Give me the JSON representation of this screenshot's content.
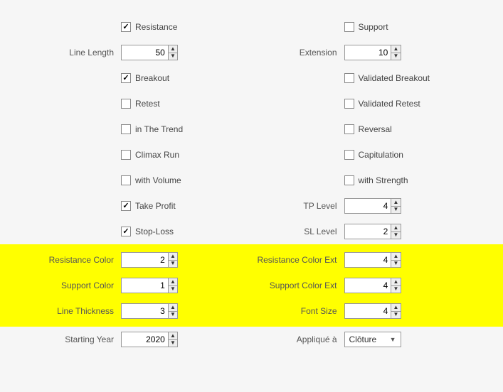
{
  "checkboxes": {
    "resistance": "Resistance",
    "support": "Support",
    "breakout": "Breakout",
    "validated_breakout": "Validated Breakout",
    "retest": "Retest",
    "validated_retest": "Validated Retest",
    "in_the_trend": "in The Trend",
    "reversal": "Reversal",
    "climax_run": "Climax Run",
    "capitulation": "Capitulation",
    "with_volume": "with Volume",
    "with_strength": "with Strength",
    "take_profit": "Take Profit",
    "stop_loss": "Stop-Loss"
  },
  "labels": {
    "line_length": "Line Length",
    "extension": "Extension",
    "tp_level": "TP Level",
    "sl_level": "SL Level",
    "resistance_color": "Resistance Color",
    "resistance_color_ext": "Resistance Color Ext",
    "support_color": "Support Color",
    "support_color_ext": "Support Color Ext",
    "line_thickness": "Line Thickness",
    "font_size": "Font Size",
    "starting_year": "Starting Year",
    "applique_a": "Appliqué à"
  },
  "values": {
    "line_length": "50",
    "extension": "10",
    "tp_level": "4",
    "sl_level": "2",
    "resistance_color": "2",
    "resistance_color_ext": "4",
    "support_color": "1",
    "support_color_ext": "4",
    "line_thickness": "3",
    "font_size": "4",
    "starting_year": "2020",
    "applique_a": "Clôture"
  }
}
